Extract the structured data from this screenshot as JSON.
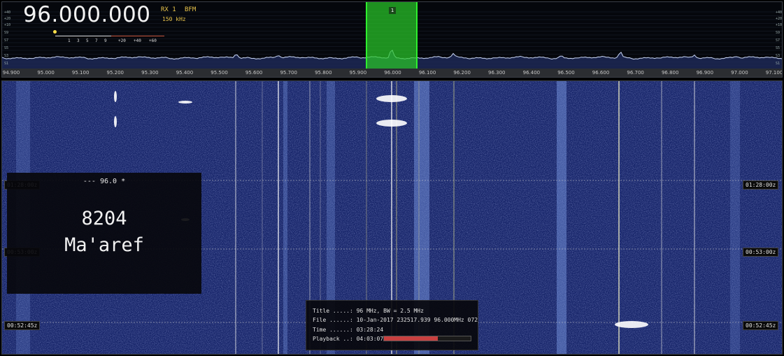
{
  "receiver": {
    "frequency": "96.000.000",
    "rx": "RX 1",
    "mode": "BFM",
    "bandwidth": "150 kHz",
    "vfo_number": "1"
  },
  "smeter": {
    "ticks": [
      "1",
      "3",
      "5",
      "7",
      "9",
      "+20",
      "+40",
      "+60"
    ]
  },
  "spectrum_axis_left": [
    "+40",
    "+20",
    "+10",
    "S9",
    "S7",
    "S5",
    "S3",
    "S1"
  ],
  "spectrum_axis_right": [
    "+40",
    "+20",
    "+10",
    "S9",
    "S7",
    "S5",
    "S3",
    "S1"
  ],
  "frequency_scale": [
    "94.900",
    "95.000",
    "95.100",
    "95.200",
    "95.300",
    "95.400",
    "95.500",
    "95.600",
    "95.700",
    "95.800",
    "95.900",
    "96.000",
    "96.100",
    "96.200",
    "96.300",
    "96.400",
    "96.500",
    "96.600",
    "96.700",
    "96.800",
    "96.900",
    "97.000",
    "97.100"
  ],
  "waterfall_times": [
    "01:28:00z",
    "00:53:00z",
    "00:52:45z"
  ],
  "station": {
    "line": "---    96.0    *",
    "code": "8204",
    "name": "Ma'aref"
  },
  "info": {
    "title_row": "Title .....: 96 MHz, BW = 2.5 MHz",
    "file_row": "File ......: 10-Jan-2017 232517.939 96.000MHz 072",
    "time_row": "Time ......: 03:28:24",
    "playback_row": "Playback ..: 04:03:07",
    "playback_progress": 0.62
  },
  "colors": {
    "vfo": "#2ef02e",
    "accent": "#e9c44b",
    "waterfall_bg": "#1b2a72",
    "progress": "#c84040"
  }
}
